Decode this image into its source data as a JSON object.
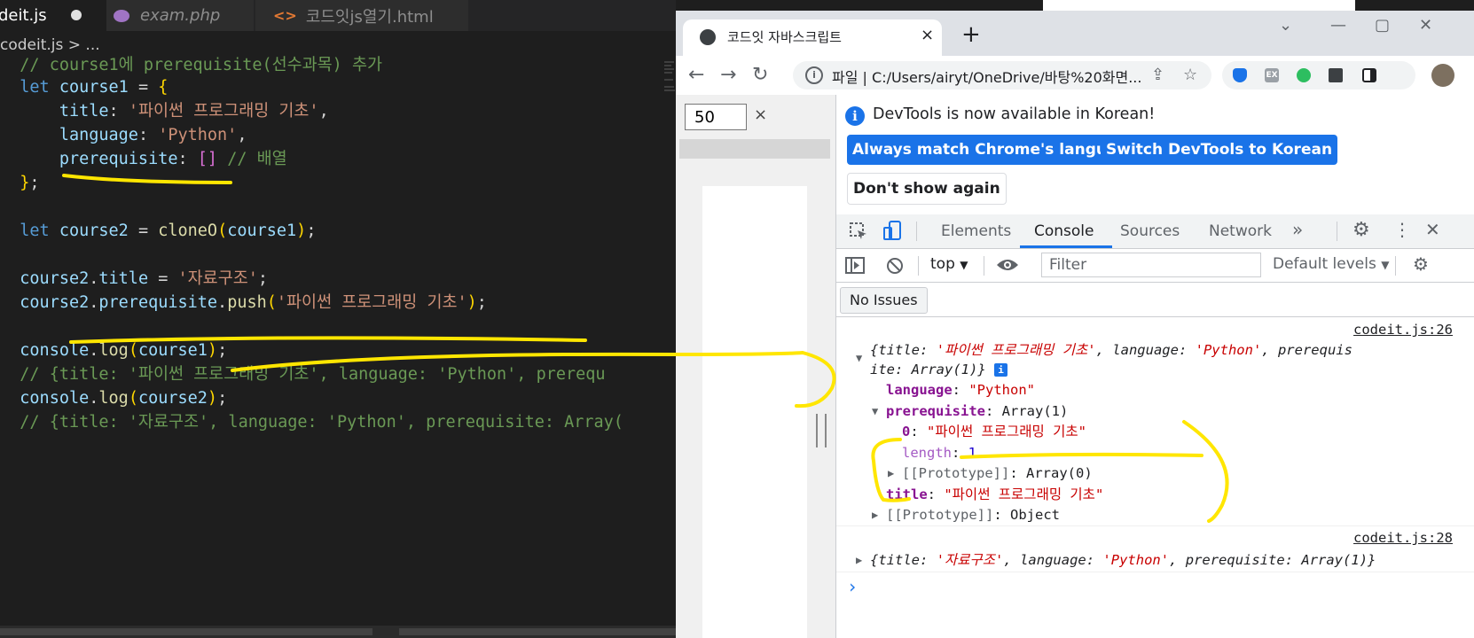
{
  "editor": {
    "tabs": [
      {
        "label": "deit.js",
        "modified": true
      },
      {
        "label": "exam.php"
      },
      {
        "label": "코드잇js열기.html"
      }
    ],
    "breadcrumb": "codeit.js > ...",
    "lines": [
      "// course1에 prerequisite(선수과목) 추가",
      "let course1 = {",
      "    title: '파이썬 프로그래밍 기초',",
      "    language: 'Python',",
      "    prerequisite: [] // 배열",
      "};",
      "",
      "let course2 = cloneO(course1);",
      "",
      "course2.title = '자료구조';",
      "course2.prerequisite.push('파이썬 프로그래밍 기초');",
      "",
      "console.log(course1);",
      "// {title: '파이썬 프로그래밍 기초', language: 'Python', prerequ",
      "console.log(course2);",
      "// {title: '자료구조', language: 'Python', prerequisite: Array("
    ]
  },
  "browser": {
    "tab_title": "코드잇 자바스크립트",
    "close": "×",
    "new_tab": "+",
    "url_scheme": "파일",
    "url": "C:/Users/airyt/OneDrive/바탕%20화면...",
    "ext_label": "EX",
    "page": {
      "number_value": "50",
      "clear": "×"
    },
    "devtools": {
      "banner": {
        "info": "i",
        "message": "DevTools is now available in Korean!",
        "btn_match": "Always match Chrome's language",
        "btn_switch": "Switch DevTools to Korean",
        "btn_dismiss": "Don't show again"
      },
      "tabs": [
        "Elements",
        "Console",
        "Sources",
        "Network"
      ],
      "more": "»",
      "context": "top",
      "filter_placeholder": "Filter",
      "levels": "Default levels",
      "no_issues": "No Issues",
      "console": {
        "entry1": {
          "source": "codeit.js:26",
          "summary_line1_open": "{",
          "k_title": "title",
          "v_title": "'파이썬 프로그래밍 기초'",
          "k_language": "language",
          "v_language": "'Python'",
          "k_prereq_short": "prerequis",
          "k_prereq_tail": "ite",
          "v_prereq": "Array(1)",
          "close": "}",
          "language_line_key": "language",
          "language_line_val": "\"Python\"",
          "prereq_key": "prerequisite",
          "prereq_val": "Array(1)",
          "item0_key": "0",
          "item0_val": "\"파이썬 프로그래밍 기초\"",
          "length_key": "length",
          "length_val": "1",
          "proto_arr": "[[Prototype]]",
          "proto_arr_val": "Array(0)",
          "title_key": "title",
          "title_val": "\"파이썬 프로그래밍 기초\"",
          "proto_obj": "[[Prototype]]",
          "proto_obj_val": "Object"
        },
        "entry2": {
          "source": "codeit.js:28",
          "k_title": "title",
          "v_title": "'자료구조'",
          "k_language": "language",
          "v_language": "'Python'",
          "k_prereq": "prerequisite",
          "v_prereq": "Array(1)"
        },
        "prompt": "›"
      }
    }
  },
  "colors": {
    "editor_bg": "#1e1e1e",
    "annotation": "#ffe600",
    "devtools_accent": "#1a73e8"
  }
}
